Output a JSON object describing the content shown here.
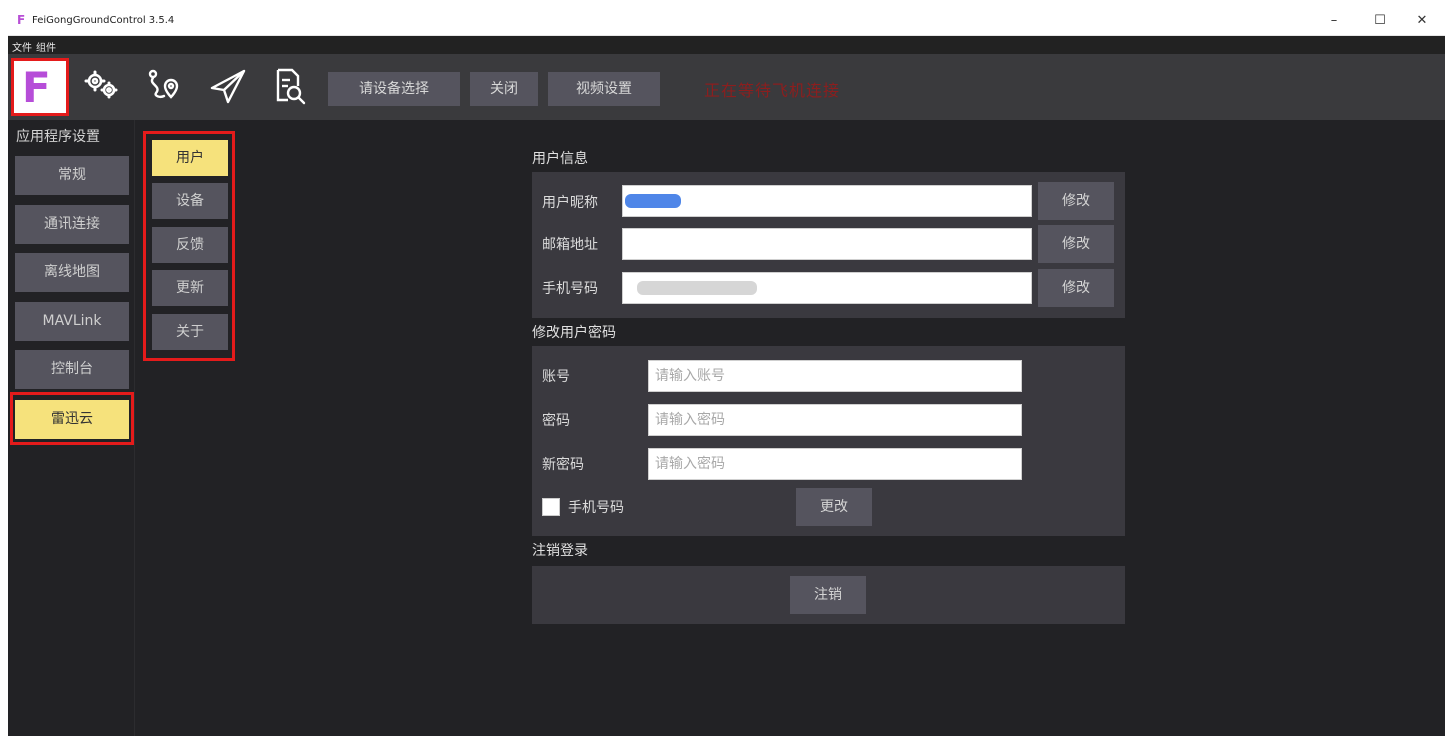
{
  "window": {
    "title": "FeiGongGroundControl 3.5.4",
    "app_icon": "F",
    "minimize": "–",
    "maximize": "☐",
    "close": "✕"
  },
  "menu": {
    "file": "文件",
    "component": "组件"
  },
  "toolbar": {
    "logo_letter": "F",
    "icons": [
      "settings-gears-icon",
      "route-plan-icon",
      "send-plane-icon",
      "document-inspect-icon"
    ],
    "device_select": "请设备选择",
    "close": "关闭",
    "video_settings": "视频设置",
    "status": "正在等待飞机连接",
    "status_color": "#8c1e1e",
    "accent_color": "#b64dd8"
  },
  "left_nav": {
    "heading": "应用程序设置",
    "items": [
      "常规",
      "通讯连接",
      "离线地图",
      "MAVLink",
      "控制台",
      "雷迅云"
    ],
    "active_index": 5
  },
  "sub_nav": {
    "items": [
      "用户",
      "设备",
      "反馈",
      "更新",
      "关于"
    ],
    "active_index": 0
  },
  "user_info": {
    "title": "用户信息",
    "nickname_label": "用户昵称",
    "email_label": "邮箱地址",
    "phone_label": "手机号码",
    "edit_label": "修改"
  },
  "change_password": {
    "title": "修改用户密码",
    "account_label": "账号",
    "account_placeholder": "请输入账号",
    "password_label": "密码",
    "password_placeholder": "请输入密码",
    "new_password_label": "新密码",
    "new_password_placeholder": "请输入密码",
    "phone_checkbox_label": "手机号码",
    "submit_label": "更改"
  },
  "logout": {
    "title": "注销登录",
    "button_label": "注销"
  }
}
